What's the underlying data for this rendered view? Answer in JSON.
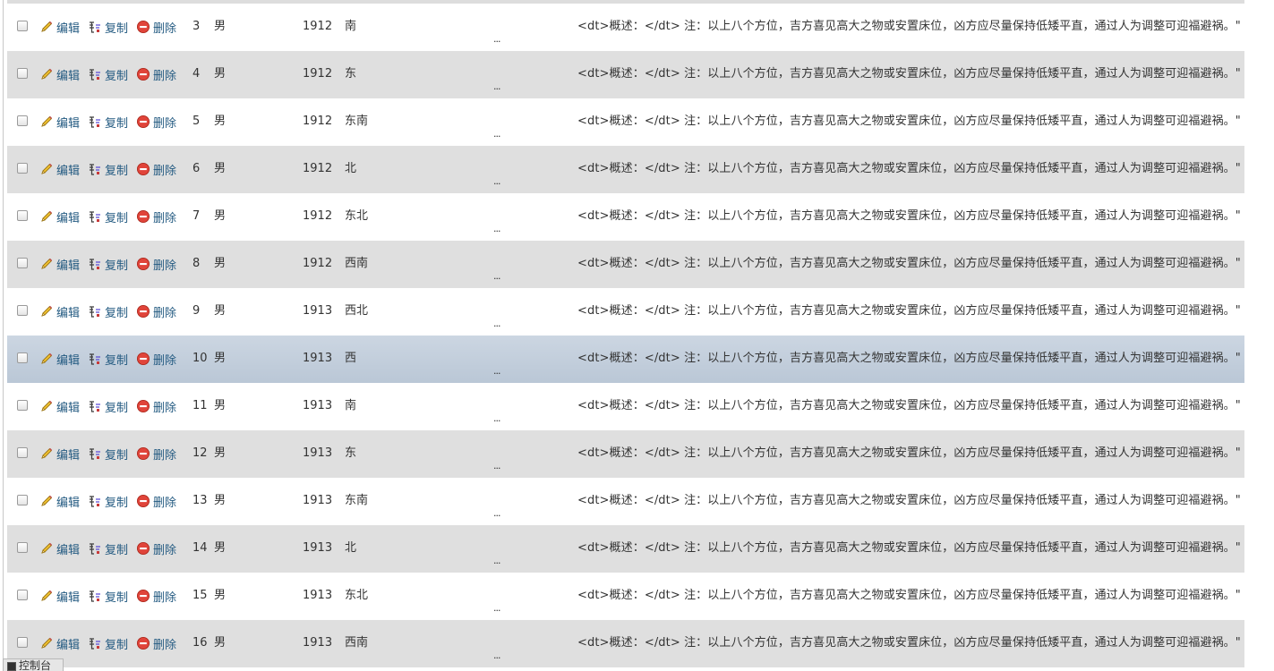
{
  "actions": {
    "edit_label": "编辑",
    "copy_label": "复制",
    "delete_label": "删除"
  },
  "truncation_marker": "...",
  "rows": [
    {
      "id": "3",
      "sex": "男",
      "year": "1912",
      "direction": "南",
      "description": "<dt>概述：</dt> 注：以上八个方位，吉方喜见高大之物或安置床位，凶方应尽量保持低矮平直，通过人为调整可迎福避祸。\""
    },
    {
      "id": "4",
      "sex": "男",
      "year": "1912",
      "direction": "东",
      "description": "<dt>概述：</dt> 注：以上八个方位，吉方喜见高大之物或安置床位，凶方应尽量保持低矮平直，通过人为调整可迎福避祸。\""
    },
    {
      "id": "5",
      "sex": "男",
      "year": "1912",
      "direction": "东南",
      "description": "<dt>概述：</dt> 注：以上八个方位，吉方喜见高大之物或安置床位，凶方应尽量保持低矮平直，通过人为调整可迎福避祸。\""
    },
    {
      "id": "6",
      "sex": "男",
      "year": "1912",
      "direction": "北",
      "description": "<dt>概述：</dt> 注：以上八个方位，吉方喜见高大之物或安置床位，凶方应尽量保持低矮平直，通过人为调整可迎福避祸。\""
    },
    {
      "id": "7",
      "sex": "男",
      "year": "1912",
      "direction": "东北",
      "description": "<dt>概述：</dt> 注：以上八个方位，吉方喜见高大之物或安置床位，凶方应尽量保持低矮平直，通过人为调整可迎福避祸。\""
    },
    {
      "id": "8",
      "sex": "男",
      "year": "1912",
      "direction": "西南",
      "description": "<dt>概述：</dt> 注：以上八个方位，吉方喜见高大之物或安置床位，凶方应尽量保持低矮平直，通过人为调整可迎福避祸。\""
    },
    {
      "id": "9",
      "sex": "男",
      "year": "1913",
      "direction": "西北",
      "description": "<dt>概述：</dt> 注：以上八个方位，吉方喜见高大之物或安置床位，凶方应尽量保持低矮平直，通过人为调整可迎福避祸。\""
    },
    {
      "id": "10",
      "sex": "男",
      "year": "1913",
      "direction": "西",
      "description": "<dt>概述：</dt> 注：以上八个方位，吉方喜见高大之物或安置床位，凶方应尽量保持低矮平直，通过人为调整可迎福避祸。\"",
      "selected": true
    },
    {
      "id": "11",
      "sex": "男",
      "year": "1913",
      "direction": "南",
      "description": "<dt>概述：</dt> 注：以上八个方位，吉方喜见高大之物或安置床位，凶方应尽量保持低矮平直，通过人为调整可迎福避祸。\""
    },
    {
      "id": "12",
      "sex": "男",
      "year": "1913",
      "direction": "东",
      "description": "<dt>概述：</dt> 注：以上八个方位，吉方喜见高大之物或安置床位，凶方应尽量保持低矮平直，通过人为调整可迎福避祸。\""
    },
    {
      "id": "13",
      "sex": "男",
      "year": "1913",
      "direction": "东南",
      "description": "<dt>概述：</dt> 注：以上八个方位，吉方喜见高大之物或安置床位，凶方应尽量保持低矮平直，通过人为调整可迎福避祸。\""
    },
    {
      "id": "14",
      "sex": "男",
      "year": "1913",
      "direction": "北",
      "description": "<dt>概述：</dt> 注：以上八个方位，吉方喜见高大之物或安置床位，凶方应尽量保持低矮平直，通过人为调整可迎福避祸。\""
    },
    {
      "id": "15",
      "sex": "男",
      "year": "1913",
      "direction": "东北",
      "description": "<dt>概述：</dt> 注：以上八个方位，吉方喜见高大之物或安置床位，凶方应尽量保持低矮平直，通过人为调整可迎福避祸。\""
    },
    {
      "id": "16",
      "sex": "男",
      "year": "1913",
      "direction": "西南",
      "description": "<dt>概述：</dt> 注：以上八个方位，吉方喜见高大之物或安置床位，凶方应尽量保持低矮平直，通过人为调整可迎福避祸。\""
    }
  ],
  "console": {
    "label": "控制台"
  },
  "colors": {
    "row_even": "#ffffff",
    "row_odd": "#dfdfdf",
    "row_selected": "#c3cfdc",
    "action_link": "#235a81",
    "delete_icon": "#d9372b",
    "pencil_icon": "#e8b830"
  },
  "icons": {
    "edit": "pencil-icon",
    "copy": "copy-icon",
    "delete": "delete-circle-icon",
    "console": "console-icon"
  }
}
